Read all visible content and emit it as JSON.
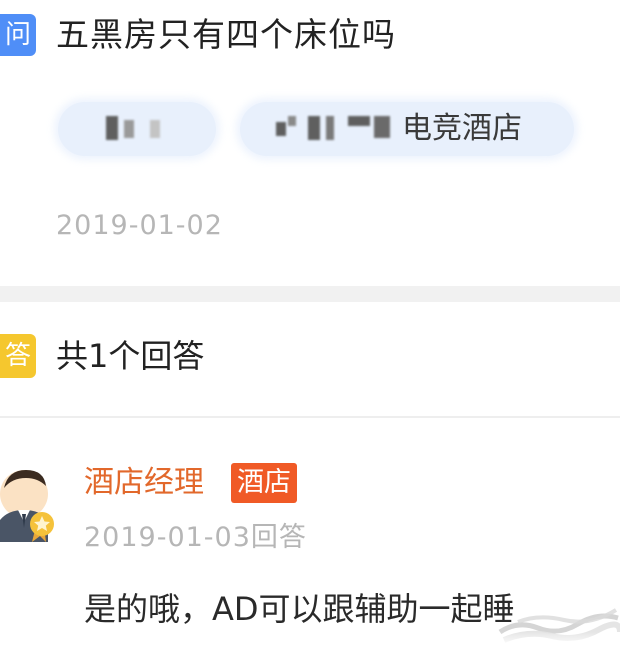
{
  "question": {
    "badge": "问",
    "title": "五黑房只有四个床位吗",
    "tags": [
      {
        "label": ""
      },
      {
        "label": "电竞酒店"
      }
    ],
    "date": "2019-01-02"
  },
  "answers_header": {
    "badge": "答",
    "count_label": "共1个回答"
  },
  "answers": [
    {
      "author": "酒店经理",
      "role_badge": "酒店",
      "date": "2019-01-03回答",
      "text": "是的哦，AD可以跟辅助一起睡"
    }
  ],
  "colors": {
    "question_badge": "#4f8ef7",
    "answer_badge": "#f5c72e",
    "author_name": "#e2682b",
    "role_badge": "#f05a26",
    "tag_background": "#e8f0fc",
    "meta_text": "#b6b6b6"
  },
  "icons": {
    "avatar": "manager-avatar-with-medal-icon"
  }
}
